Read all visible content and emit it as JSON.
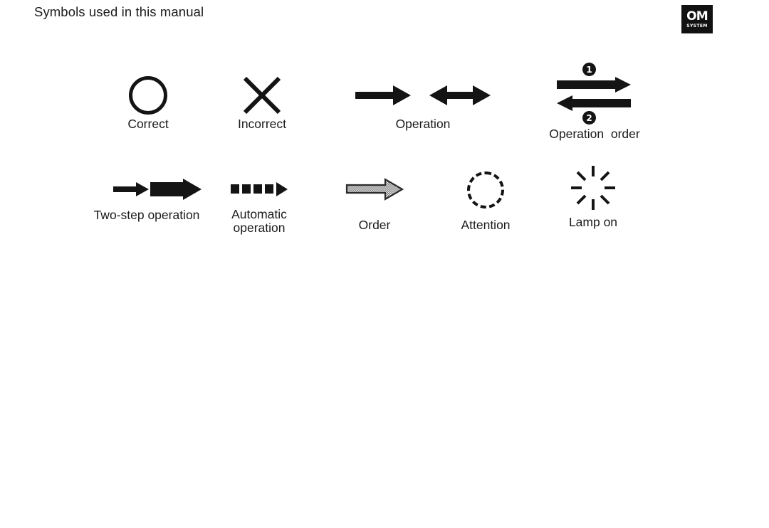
{
  "header": {
    "title": "Symbols used in this manual",
    "logo": {
      "name": "om-system-logo",
      "primary_text": "OM",
      "secondary_text": "SYSTEM",
      "background_color": "#111111",
      "text_color": "#ffffff"
    }
  },
  "colors": {
    "page_background": "#ffffff",
    "ink": "#141414",
    "text": "#1b1b1b",
    "order_arrow_fill": "#9a9a9a",
    "order_arrow_stroke": "#2a2a2a"
  },
  "legend": {
    "rows": [
      {
        "row": 1,
        "items": [
          {
            "icon": "circle-outline-icon",
            "label": "Correct",
            "meaning": "Correct"
          },
          {
            "icon": "x-cross-icon",
            "label": "Incorrect",
            "meaning": "Incorrect"
          },
          {
            "icon": "arrow-right-and-double-arrow-icon",
            "label": "Operation",
            "meaning": "Operation"
          },
          {
            "icon": "numbered-opposing-arrows-icon",
            "label": "Operation  order",
            "meaning": "Operation order",
            "badges": [
              "1",
              "2"
            ]
          }
        ]
      },
      {
        "row": 2,
        "items": [
          {
            "icon": "thin-then-thick-arrow-icon",
            "label": "Two-step operation",
            "meaning": "Two-step operation"
          },
          {
            "icon": "dashed-square-arrow-icon",
            "label_line1": "Automatic",
            "label_line2": "operation",
            "meaning": "Automatic operation"
          },
          {
            "icon": "hatched-outline-arrow-icon",
            "label": "Order",
            "meaning": "Order"
          },
          {
            "icon": "dashed-circle-icon",
            "label": "Attention",
            "meaning": "Attention"
          },
          {
            "icon": "starburst-lamp-icon",
            "label": "Lamp on",
            "meaning": "Lamp on"
          }
        ]
      }
    ]
  }
}
